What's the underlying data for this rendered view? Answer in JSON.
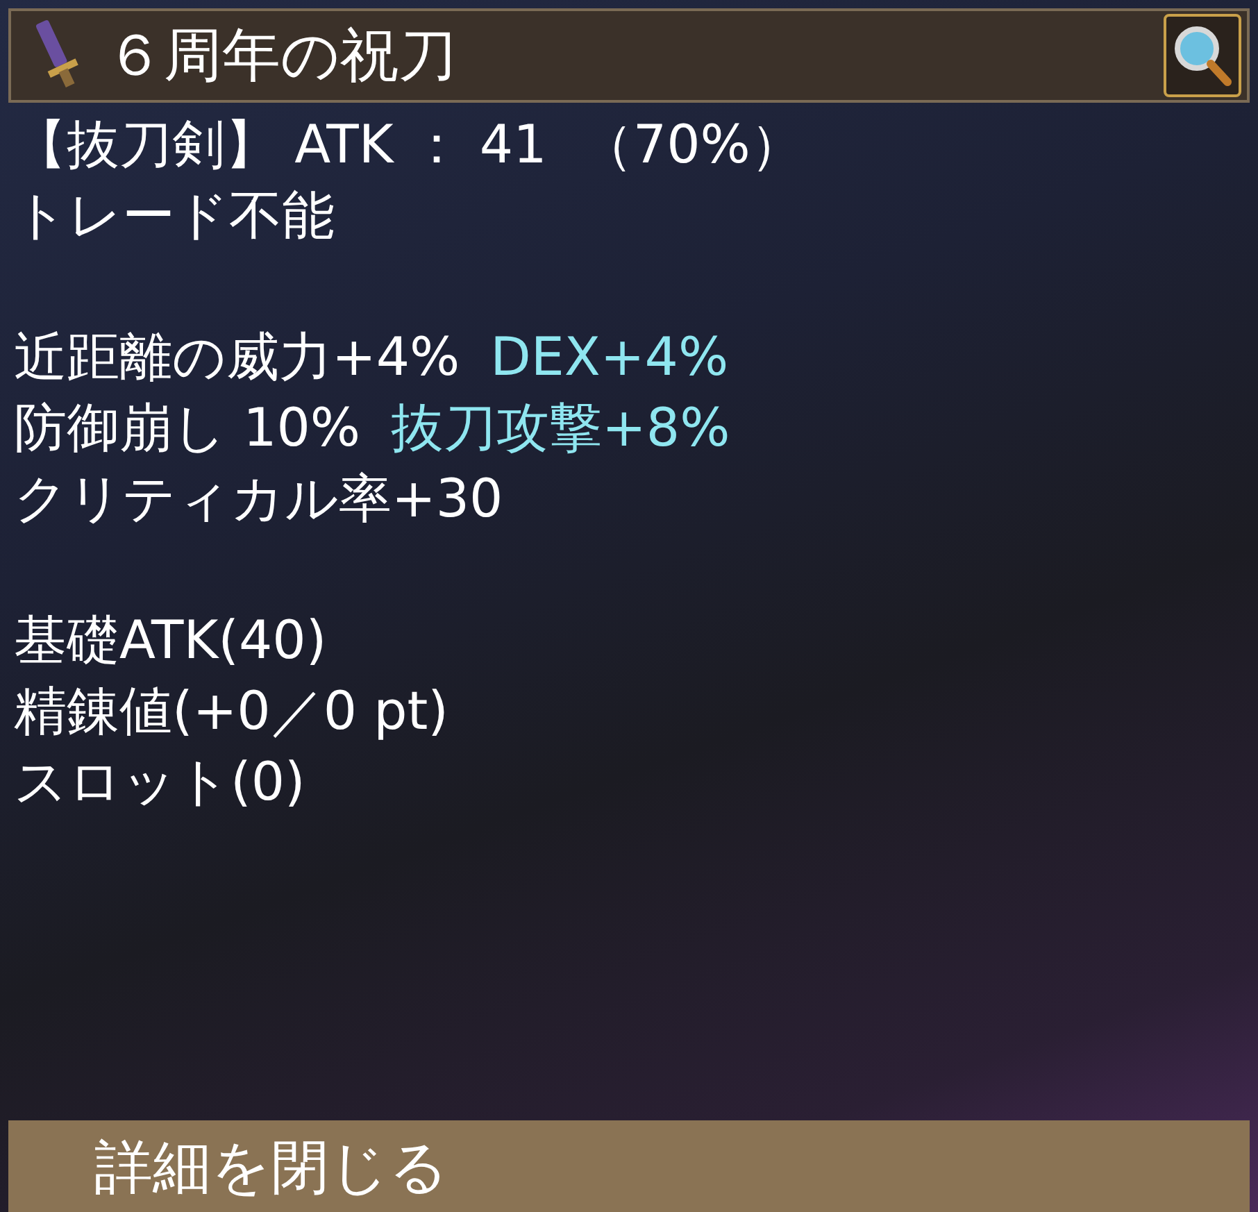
{
  "title": "６周年の祝刀",
  "sections": [
    [
      {
        "segments": [
          {
            "text": "【抜刀剣】 ATK ： 41  （70%）",
            "highlight": false
          }
        ]
      },
      {
        "segments": [
          {
            "text": "トレード不能",
            "highlight": false
          }
        ]
      }
    ],
    [
      {
        "segments": [
          {
            "text": "近距離の威力+4%",
            "highlight": false
          },
          {
            "text": "DEX+4%",
            "highlight": true
          }
        ]
      },
      {
        "segments": [
          {
            "text": "防御崩し 10%",
            "highlight": false
          },
          {
            "text": "抜刀攻撃+8%",
            "highlight": true
          }
        ]
      },
      {
        "segments": [
          {
            "text": "クリティカル率+30",
            "highlight": false
          }
        ]
      }
    ],
    [
      {
        "segments": [
          {
            "text": "基礎ATK(40)",
            "highlight": false
          }
        ]
      },
      {
        "segments": [
          {
            "text": "精錬値(+0／0 pt)",
            "highlight": false
          }
        ]
      },
      {
        "segments": [
          {
            "text": "スロット(0)",
            "highlight": false
          }
        ]
      }
    ]
  ],
  "close_button": "詳細を閉じる"
}
